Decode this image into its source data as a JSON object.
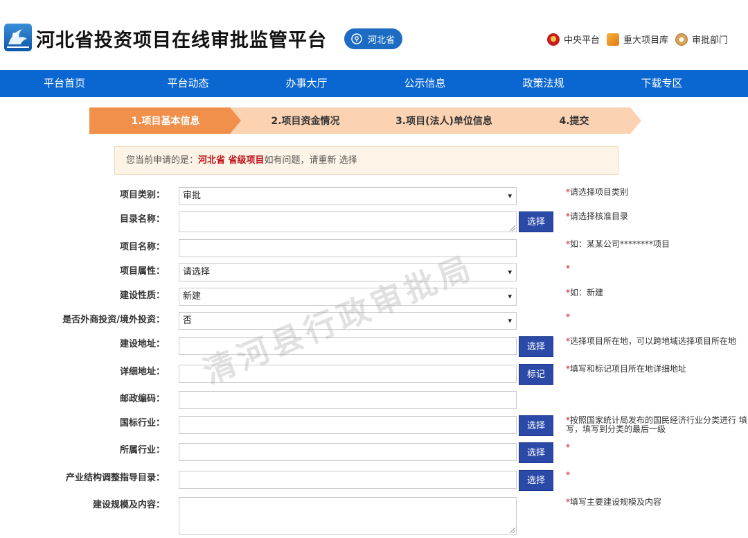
{
  "header": {
    "title": "河北省投资项目在线审批监管平台",
    "region": "河北省",
    "links": [
      {
        "label": "中央平台",
        "icon": "national-emblem-icon"
      },
      {
        "label": "重大项目库",
        "icon": "box-icon"
      },
      {
        "label": "审批部门",
        "icon": "building-icon"
      }
    ]
  },
  "nav": [
    "平台首页",
    "平台动态",
    "办事大厅",
    "公示信息",
    "政策法规",
    "下载专区"
  ],
  "steps": [
    "1.项目基本信息",
    "2.项目资金情况",
    "3.项目(法人)单位信息",
    "4.提交"
  ],
  "notice": {
    "prefix": "您当前申请的是：",
    "highlight": "河北省 省级项目",
    "suffix": "如有问题，请重新 选择"
  },
  "form": {
    "rows": [
      {
        "label": "项目类别：",
        "value": "审批",
        "type": "select",
        "hint": "请选择项目类别"
      },
      {
        "label": "目录名称：",
        "value": "",
        "type": "textarea",
        "button": "选择",
        "hint": "请选择核准目录"
      },
      {
        "label": "项目名称：",
        "value": "",
        "type": "input",
        "hint": "如：某某公司********项目"
      },
      {
        "label": "项目属性：",
        "value": "请选择",
        "type": "select",
        "hint": ""
      },
      {
        "label": "建设性质：",
        "value": "新建",
        "type": "select",
        "hint": "如：新建"
      },
      {
        "label": "是否外商投资/境外投资：",
        "value": "否",
        "type": "select",
        "hint": ""
      },
      {
        "label": "建设地址：",
        "value": "",
        "type": "input",
        "button": "选择",
        "hint": "选择项目所在地，可以跨地域选择项目所在地"
      },
      {
        "label": "详细地址：",
        "value": "",
        "type": "input",
        "button": "标记",
        "hint": "填写和标记项目所在地详细地址"
      },
      {
        "label": "邮政编码：",
        "value": "",
        "type": "input",
        "hint": null
      },
      {
        "label": "国标行业：",
        "value": "",
        "type": "input",
        "button": "选择",
        "hint": "按照国家统计局发布的国民经济行业分类进行 填写，填写到分类的最后一级"
      },
      {
        "label": "所属行业：",
        "value": "",
        "type": "input",
        "button": "选择",
        "hint": ""
      },
      {
        "label": "产业结构调整指导目录：",
        "value": "",
        "type": "input",
        "button": "选择",
        "hint": ""
      },
      {
        "label": "建设规模及内容：",
        "value": "",
        "type": "textarea",
        "hint": "填写主要建设规模及内容"
      }
    ],
    "required_mark": "*"
  },
  "watermark": "清河县行政审批局",
  "colors": {
    "nav": "#0a66d0",
    "step_active": "#f0904a",
    "step_inactive": "#fbd2b2",
    "button": "#2b4aa8",
    "required": "#d0101b"
  }
}
